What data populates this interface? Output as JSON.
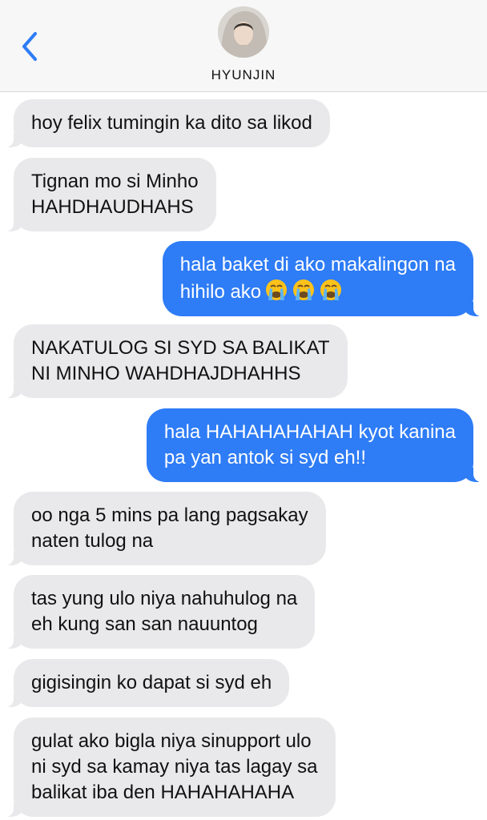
{
  "header": {
    "contact_name": "HYUNJIN",
    "back_icon": "chevron-left-icon",
    "accent_color": "#2e7cf6"
  },
  "messages": [
    {
      "direction": "incoming",
      "text": "hoy felix tumingin ka dito sa likod"
    },
    {
      "direction": "incoming",
      "text": "Tignan mo si Minho\nHAHDHAUDHAHS"
    },
    {
      "direction": "outgoing",
      "text": "hala baket di ako makalingon na\nhihilo ako",
      "emoji": [
        "loudly-crying-face",
        "loudly-crying-face",
        "loudly-crying-face"
      ]
    },
    {
      "direction": "incoming",
      "text": "NAKATULOG SI SYD SA BALIKAT\nNI MINHO WAHDHAJDHAHHS"
    },
    {
      "direction": "outgoing",
      "text": "hala HAHAHAHAHAH kyot kanina\npa yan antok si syd eh!!"
    },
    {
      "direction": "incoming",
      "text": "oo nga 5 mins pa lang pagsakay\nnaten tulog na"
    },
    {
      "direction": "incoming",
      "text": "tas yung ulo niya nahuhulog na\neh kung san san nauuntog"
    },
    {
      "direction": "incoming",
      "text": "gigisingin ko dapat si syd eh"
    },
    {
      "direction": "incoming",
      "text": "gulat ako bigla niya sinupport ulo\nni syd sa kamay niya tas lagay sa\nbalikat iba den HAHAHAHAHA"
    }
  ]
}
